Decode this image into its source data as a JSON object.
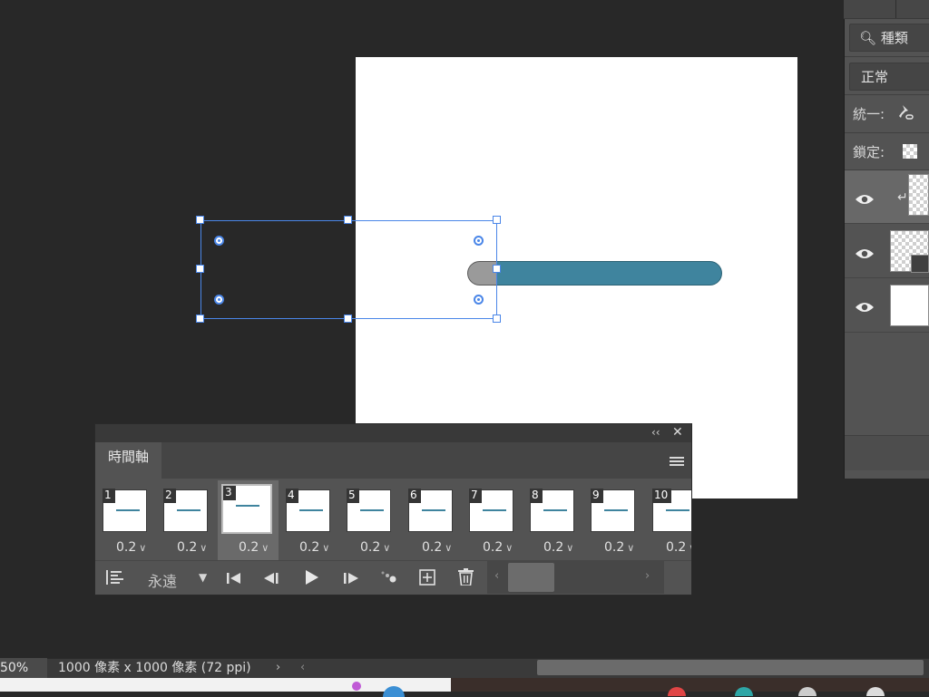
{
  "timeline": {
    "tab_label": "時間軸",
    "loop_label": "永遠",
    "frames": [
      {
        "num": "1",
        "delay": "0.2"
      },
      {
        "num": "2",
        "delay": "0.2"
      },
      {
        "num": "3",
        "delay": "0.2"
      },
      {
        "num": "4",
        "delay": "0.2"
      },
      {
        "num": "5",
        "delay": "0.2"
      },
      {
        "num": "6",
        "delay": "0.2"
      },
      {
        "num": "7",
        "delay": "0.2"
      },
      {
        "num": "8",
        "delay": "0.2"
      },
      {
        "num": "9",
        "delay": "0.2"
      },
      {
        "num": "10",
        "delay": "0.2"
      }
    ],
    "selected_frame": "3"
  },
  "layers_panel": {
    "search_label": "種類",
    "blend_mode": "正常",
    "unify_label": "統一:",
    "lock_label": "鎖定:"
  },
  "status": {
    "zoom": "50%",
    "doc_info": "1000 像素 x 1000 像素 (72 ppi)"
  },
  "colors": {
    "accent": "#3f849e",
    "selection": "#4a86e8"
  }
}
